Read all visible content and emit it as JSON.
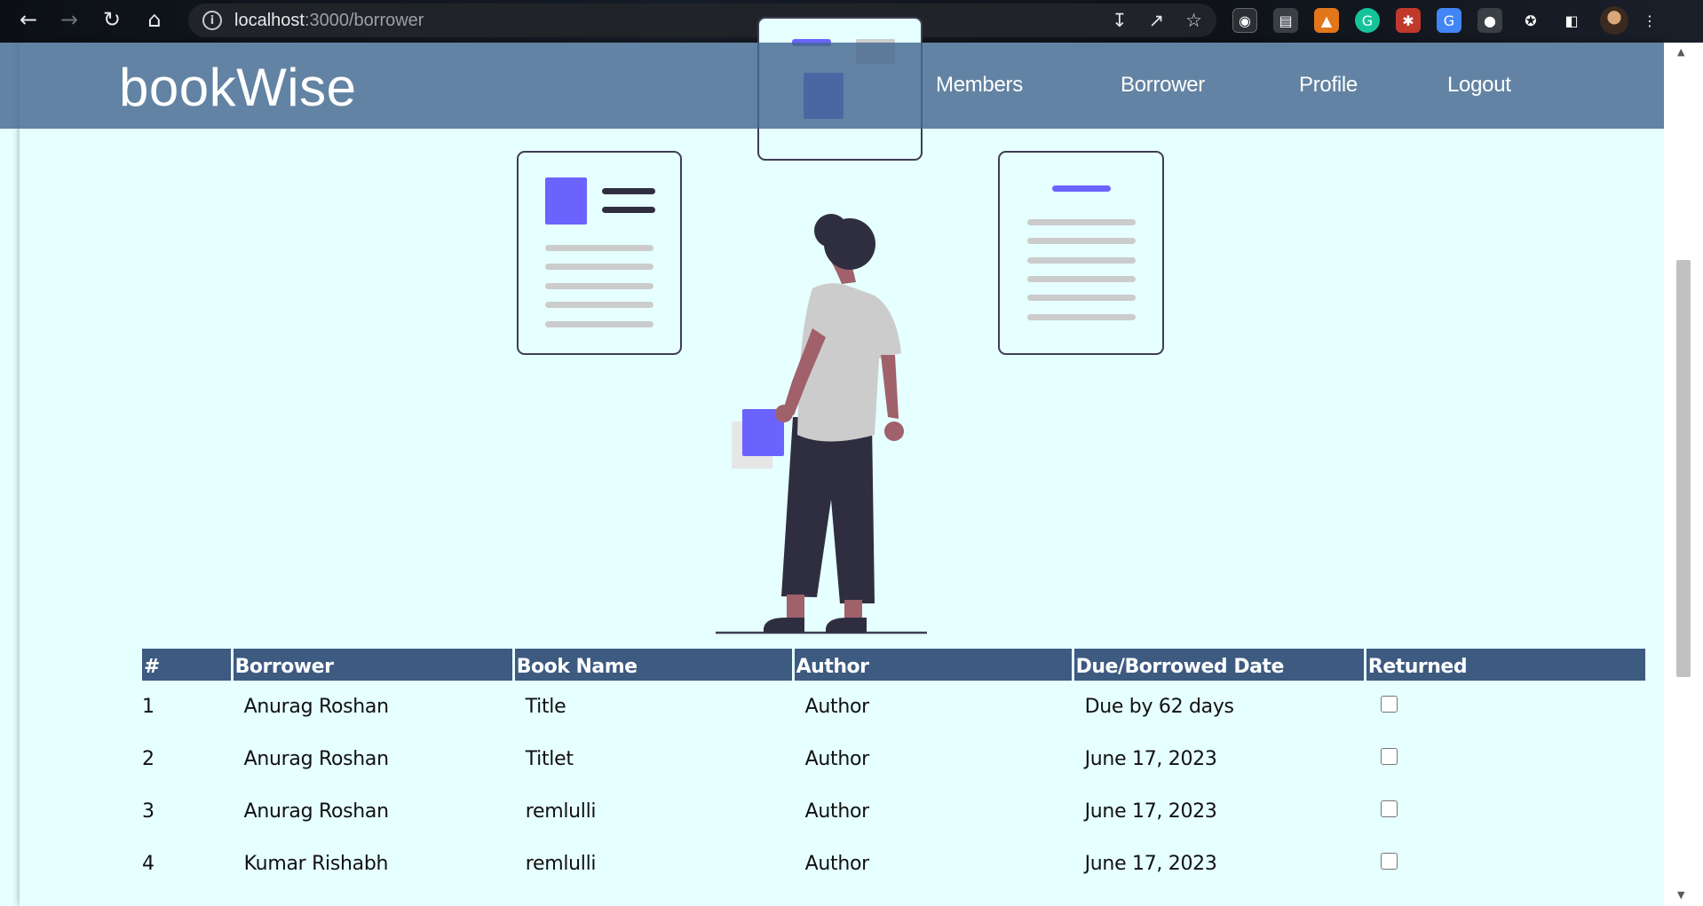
{
  "browser": {
    "url_host": "localhost",
    "url_path": ":3000/borrower"
  },
  "navbar": {
    "brand": "bookWise",
    "links": [
      {
        "label": "Members"
      },
      {
        "label": "Borrower"
      },
      {
        "label": "Profile"
      },
      {
        "label": "Logout"
      }
    ]
  },
  "table": {
    "headers": [
      "#",
      "Borrower",
      "Book Name",
      "Author",
      "Due/Borrowed Date",
      "Returned"
    ],
    "rows": [
      {
        "num": "1",
        "borrower": "Anurag Roshan",
        "book": "Title",
        "author": "Author",
        "date": "Due by 62 days",
        "returned": false
      },
      {
        "num": "2",
        "borrower": "Anurag Roshan",
        "book": "Titlet",
        "author": "Author",
        "date": "June 17, 2023",
        "returned": false
      },
      {
        "num": "3",
        "borrower": "Anurag Roshan",
        "book": "remlulli",
        "author": "Author",
        "date": "June 17, 2023",
        "returned": false
      },
      {
        "num": "4",
        "borrower": "Kumar Rishabh",
        "book": "remlulli",
        "author": "Author",
        "date": "June 17, 2023",
        "returned": false
      }
    ]
  },
  "colors": {
    "page_bg": "#e6ffff",
    "navbar_bg": "#5a7896",
    "table_header_bg": "#3d5a80",
    "accent_purple": "#6c63ff"
  }
}
